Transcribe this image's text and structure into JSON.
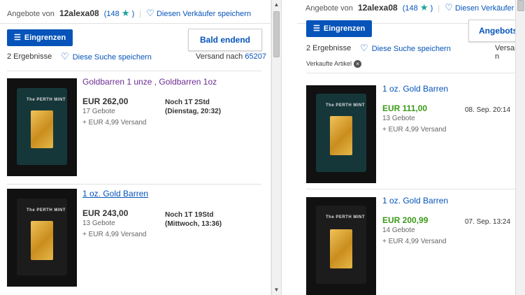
{
  "left": {
    "seller": {
      "prefix": "Angebote von",
      "name": "12alexa08",
      "feedback_open": "(",
      "feedback": "148",
      "feedback_close": ")",
      "save_seller": "Diesen Verkäufer speichern"
    },
    "filter_button": "Eingrenzen",
    "sort_label": "Bald endend",
    "results": "2 Ergebnisse",
    "save_search": "Diese Suche speichern",
    "ship_to_label": "Versand nach",
    "ship_to_zip": "65207",
    "items": [
      {
        "title": "Goldbarren 1 unze , Goldbarren 1oz",
        "price": "EUR 262,00",
        "bids": "17 Gebote",
        "shipping": "+ EUR 4,99 Versand",
        "time_left": "Noch 1T 2Std",
        "end_time": "(Dienstag, 20:32)",
        "brand": "The PERTH MINT"
      },
      {
        "title": "1 oz. Gold Barren",
        "price": "EUR 243,00",
        "bids": "13 Gebote",
        "shipping": "+ EUR 4,99 Versand",
        "time_left": "Noch 1T 19Std",
        "end_time": "(Mittwoch, 13:36)",
        "brand": "The PERTH MINT"
      }
    ]
  },
  "right": {
    "seller": {
      "prefix": "Angebote von",
      "name": "12alexa08",
      "feedback_open": "(",
      "feedback": "148",
      "feedback_close": ")",
      "save_seller": "Diesen Verkäufer speichern"
    },
    "filter_button": "Eingrenzen",
    "sort_label": "Angebotser",
    "results": "2 Ergebnisse",
    "save_search": "Diese Suche speichern",
    "ship_to_label": "Versand n",
    "chip": "Verkaufte Artikel",
    "items": [
      {
        "title": "1 oz. Gold Barren",
        "price": "EUR 111,00",
        "bids": "13 Gebote",
        "shipping": "+ EUR 4,99 Versand",
        "date": "08. Sep. 20:14",
        "brand": "The PERTH MINT"
      },
      {
        "title": "1 oz. Gold Barren",
        "price": "EUR 200,99",
        "bids": "14 Gebote",
        "shipping": "+ EUR 4,99 Versand",
        "date": "07. Sep. 13:24",
        "brand": "The PERTH MINT"
      }
    ]
  },
  "icons": {
    "star": "★",
    "heart": "♡",
    "burger": "☰",
    "close": "×",
    "up": "▲",
    "down": "▼"
  },
  "colors": {
    "link": "#0654ba",
    "sold_price": "#3a9a18",
    "visited": "#6b2c91",
    "button": "#0654ba"
  }
}
